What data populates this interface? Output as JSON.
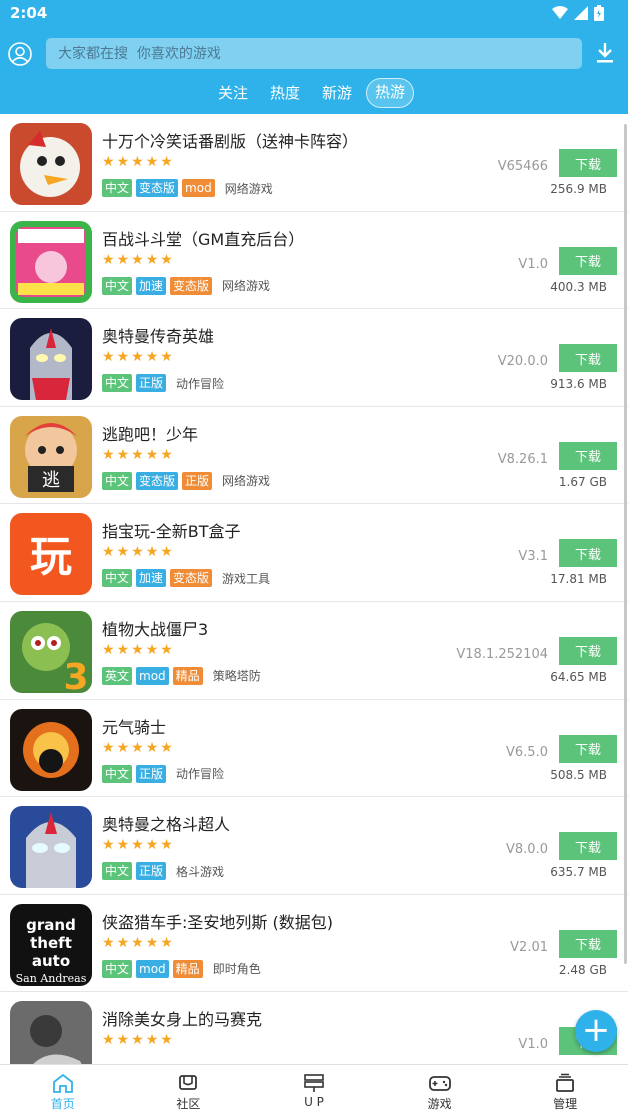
{
  "status_bar": {
    "time": "2:04"
  },
  "search": {
    "placeholder": "大家都在搜  你喜欢的游戏"
  },
  "tabs": [
    {
      "label": "关注",
      "active": false
    },
    {
      "label": "热度",
      "active": false
    },
    {
      "label": "新游",
      "active": false
    },
    {
      "label": "热游",
      "active": true
    }
  ],
  "download_label": "下载",
  "games": [
    {
      "title": "十万个冷笑话番剧版（送神卡阵容）",
      "version": "V65466",
      "size": "256.9 MB",
      "rating": 5,
      "tags": [
        {
          "text": "中文",
          "color": "green"
        },
        {
          "text": "变态版",
          "color": "blue"
        },
        {
          "text": "mod",
          "color": "orange"
        }
      ],
      "category": "网络游戏"
    },
    {
      "title": "百战斗斗堂（GM直充后台）",
      "version": "V1.0",
      "size": "400.3 MB",
      "rating": 5,
      "tags": [
        {
          "text": "中文",
          "color": "green"
        },
        {
          "text": "加速",
          "color": "blue"
        },
        {
          "text": "变态版",
          "color": "orange"
        }
      ],
      "category": "网络游戏"
    },
    {
      "title": "奥特曼传奇英雄",
      "version": "V20.0.0",
      "size": "913.6 MB",
      "rating": 5,
      "tags": [
        {
          "text": "中文",
          "color": "green"
        },
        {
          "text": "正版",
          "color": "blue"
        }
      ],
      "category": "动作冒险"
    },
    {
      "title": "逃跑吧！少年",
      "version": "V8.26.1",
      "size": "1.67 GB",
      "rating": 5,
      "tags": [
        {
          "text": "中文",
          "color": "green"
        },
        {
          "text": "变态版",
          "color": "blue"
        },
        {
          "text": "正版",
          "color": "orange"
        }
      ],
      "category": "网络游戏"
    },
    {
      "title": "指宝玩-全新BT盒子",
      "version": "V3.1",
      "size": "17.81 MB",
      "rating": 5,
      "tags": [
        {
          "text": "中文",
          "color": "green"
        },
        {
          "text": "加速",
          "color": "blue"
        },
        {
          "text": "变态版",
          "color": "orange"
        }
      ],
      "category": "游戏工具"
    },
    {
      "title": "植物大战僵尸3",
      "version": "V18.1.252104",
      "size": "64.65 MB",
      "rating": 5,
      "tags": [
        {
          "text": "英文",
          "color": "green"
        },
        {
          "text": "mod",
          "color": "blue"
        },
        {
          "text": "精品",
          "color": "orange"
        }
      ],
      "category": "策略塔防"
    },
    {
      "title": "元气骑士",
      "version": "V6.5.0",
      "size": "508.5 MB",
      "rating": 5,
      "tags": [
        {
          "text": "中文",
          "color": "green"
        },
        {
          "text": "正版",
          "color": "blue"
        }
      ],
      "category": "动作冒险"
    },
    {
      "title": "奥特曼之格斗超人",
      "version": "V8.0.0",
      "size": "635.7 MB",
      "rating": 5,
      "tags": [
        {
          "text": "中文",
          "color": "green"
        },
        {
          "text": "正版",
          "color": "blue"
        }
      ],
      "category": "格斗游戏"
    },
    {
      "title": "侠盗猎车手:圣安地列斯 (数据包)",
      "version": "V2.01",
      "size": "2.48 GB",
      "rating": 5,
      "tags": [
        {
          "text": "中文",
          "color": "green"
        },
        {
          "text": "mod",
          "color": "blue"
        },
        {
          "text": "精品",
          "color": "orange"
        }
      ],
      "category": "即时角色"
    },
    {
      "title": "消除美女身上的马赛克",
      "version": "V1.0",
      "size": "",
      "rating": 5,
      "tags": [],
      "category": ""
    }
  ],
  "bottom_nav": [
    {
      "label": "首页",
      "icon": "home-icon",
      "active": true
    },
    {
      "label": "社区",
      "icon": "community-icon",
      "active": false
    },
    {
      "label": "U P",
      "icon": "upload-icon",
      "active": false
    },
    {
      "label": "游戏",
      "icon": "gamepad-icon",
      "active": false
    },
    {
      "label": "管理",
      "icon": "manage-icon",
      "active": false
    }
  ],
  "colors": {
    "header": "#2fb2ea",
    "download_button": "#5cc37a",
    "tag_green": "#5cc37a",
    "tag_blue": "#39aee3",
    "tag_orange": "#f08c36",
    "star": "#f5a623"
  }
}
